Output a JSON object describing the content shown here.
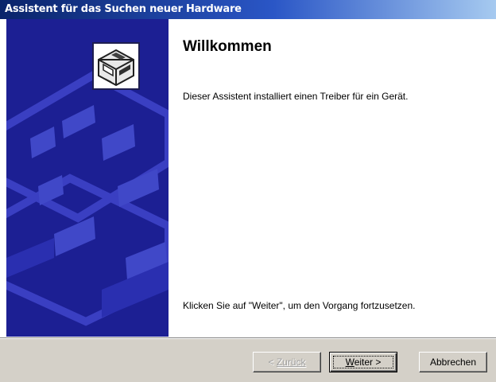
{
  "window": {
    "title": "Assistent für das Suchen neuer Hardware"
  },
  "content": {
    "heading": "Willkommen",
    "description": "Dieser Assistent installiert einen Treiber für ein Gerät.",
    "continue_hint": "Klicken Sie auf \"Weiter\", um den Vorgang fortzusetzen."
  },
  "buttons": {
    "back_prefix": "< ",
    "back_label": "Zurück",
    "next_mnemonic": "W",
    "next_rest": "eiter >",
    "cancel_label": "Abbrechen"
  },
  "icons": {
    "wizard": "hardware-drive-icon",
    "side_art": "hardware-wizard-watermark"
  },
  "colors": {
    "title_start": "#0a246a",
    "title_end": "#a6caf0",
    "side_panel": "#1c1f93",
    "dialog_face": "#d4d0c8"
  }
}
